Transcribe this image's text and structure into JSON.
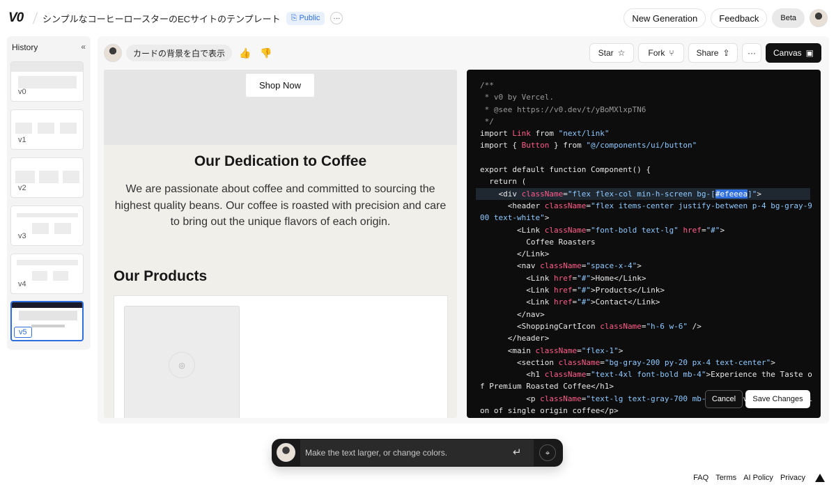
{
  "header": {
    "logo": "V0",
    "project_title": "シンプルなコーヒーロースターのECサイトのテンプレート",
    "visibility": "Public",
    "more": "···",
    "new_generation": "New Generation",
    "feedback": "Feedback",
    "beta": "Beta"
  },
  "history": {
    "title": "History",
    "collapse": "«",
    "versions": [
      "v0",
      "v1",
      "v2",
      "v3",
      "v4",
      "v5"
    ],
    "active": "v5"
  },
  "chat": {
    "message": "カードの背景を白で表示",
    "thumbs_up": "👍",
    "thumbs_down": "👎"
  },
  "toolbar": {
    "star": "Star",
    "fork": "Fork",
    "share": "Share",
    "more": "···",
    "canvas": "Canvas"
  },
  "preview": {
    "shop_now": "Shop Now",
    "dedication_title": "Our Dedication to Coffee",
    "dedication_text": "We are passionate about coffee and committed to sourcing the highest quality beans. Our coffee is roasted with precision and care to bring out the unique flavors of each origin.",
    "products_title": "Our Products"
  },
  "code": {
    "highlight_selection": "#efeeea",
    "cancel": "Cancel",
    "save": "Save Changes"
  },
  "prompt": {
    "placeholder": "Make the text larger, or change colors.",
    "enter": "↵"
  },
  "footer": {
    "links": [
      "FAQ",
      "Terms",
      "AI Policy",
      "Privacy"
    ]
  },
  "colors": {
    "accent": "#2f6fdd",
    "code_bg": "#0d0d0d",
    "preview_bg": "#f1efea"
  }
}
